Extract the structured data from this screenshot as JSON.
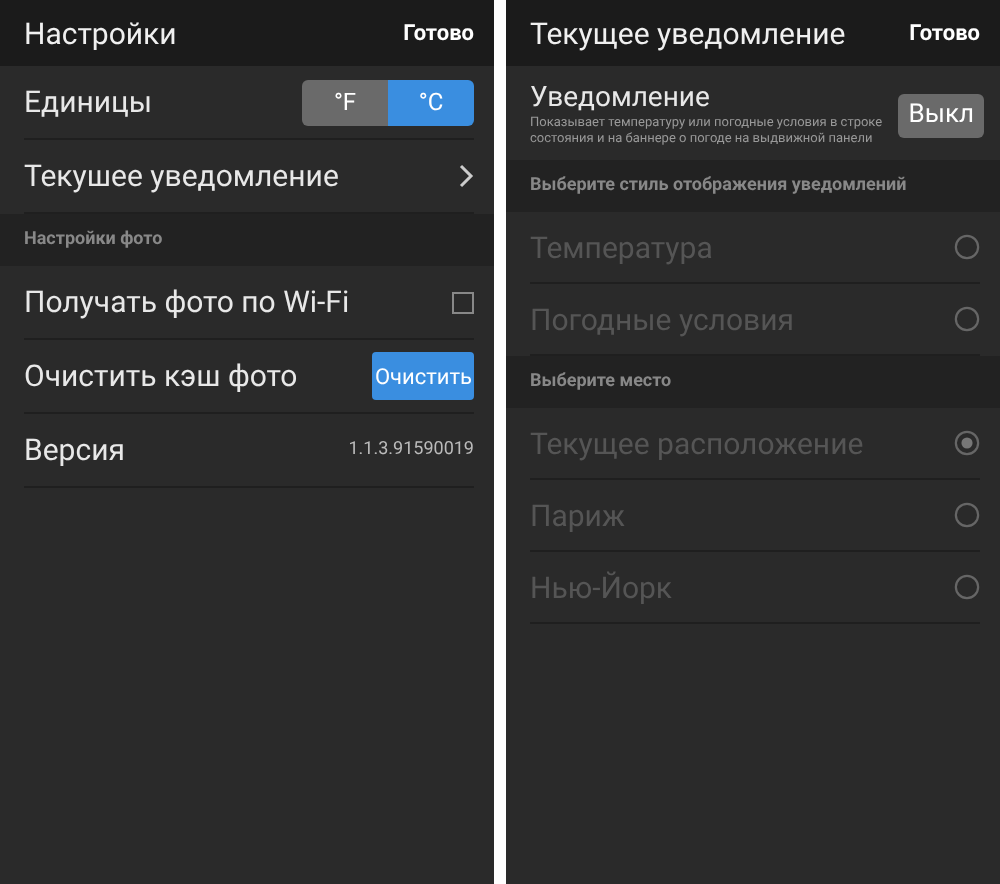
{
  "settings": {
    "title": "Настройки",
    "done": "Готово",
    "units": {
      "label": "Единицы",
      "options": [
        {
          "label": "°F",
          "selected": false
        },
        {
          "label": "°C",
          "selected": true
        }
      ]
    },
    "notification_row": {
      "label": "Текушее уведомление"
    },
    "photo_section": "Настройки фото",
    "wifi": {
      "label": "Получать фото по Wi-Fi",
      "checked": false
    },
    "cache": {
      "label": "Очистить кэш фото",
      "button": "Очистить"
    },
    "version": {
      "label": "Версия",
      "value": "1.1.3.91590019"
    }
  },
  "notification": {
    "title": "Текущее уведомление",
    "done": "Готово",
    "toggle": {
      "label": "Уведомление",
      "description": "Показывает температуру или погодные условия в строке состояния и на баннере о погоде на выдвижной панели",
      "button": "Выкл",
      "on": false
    },
    "style_section": "Выберите стиль отображения уведомлений",
    "styles": [
      {
        "label": "Температура",
        "selected": false,
        "disabled": true
      },
      {
        "label": "Погодные условия",
        "selected": false,
        "disabled": true
      }
    ],
    "place_section": "Выберите место",
    "places": [
      {
        "label": "Текущее расположение",
        "selected": true,
        "disabled": true
      },
      {
        "label": "Париж",
        "selected": false,
        "disabled": true
      },
      {
        "label": "Нью-Йорк",
        "selected": false,
        "disabled": true
      }
    ]
  }
}
